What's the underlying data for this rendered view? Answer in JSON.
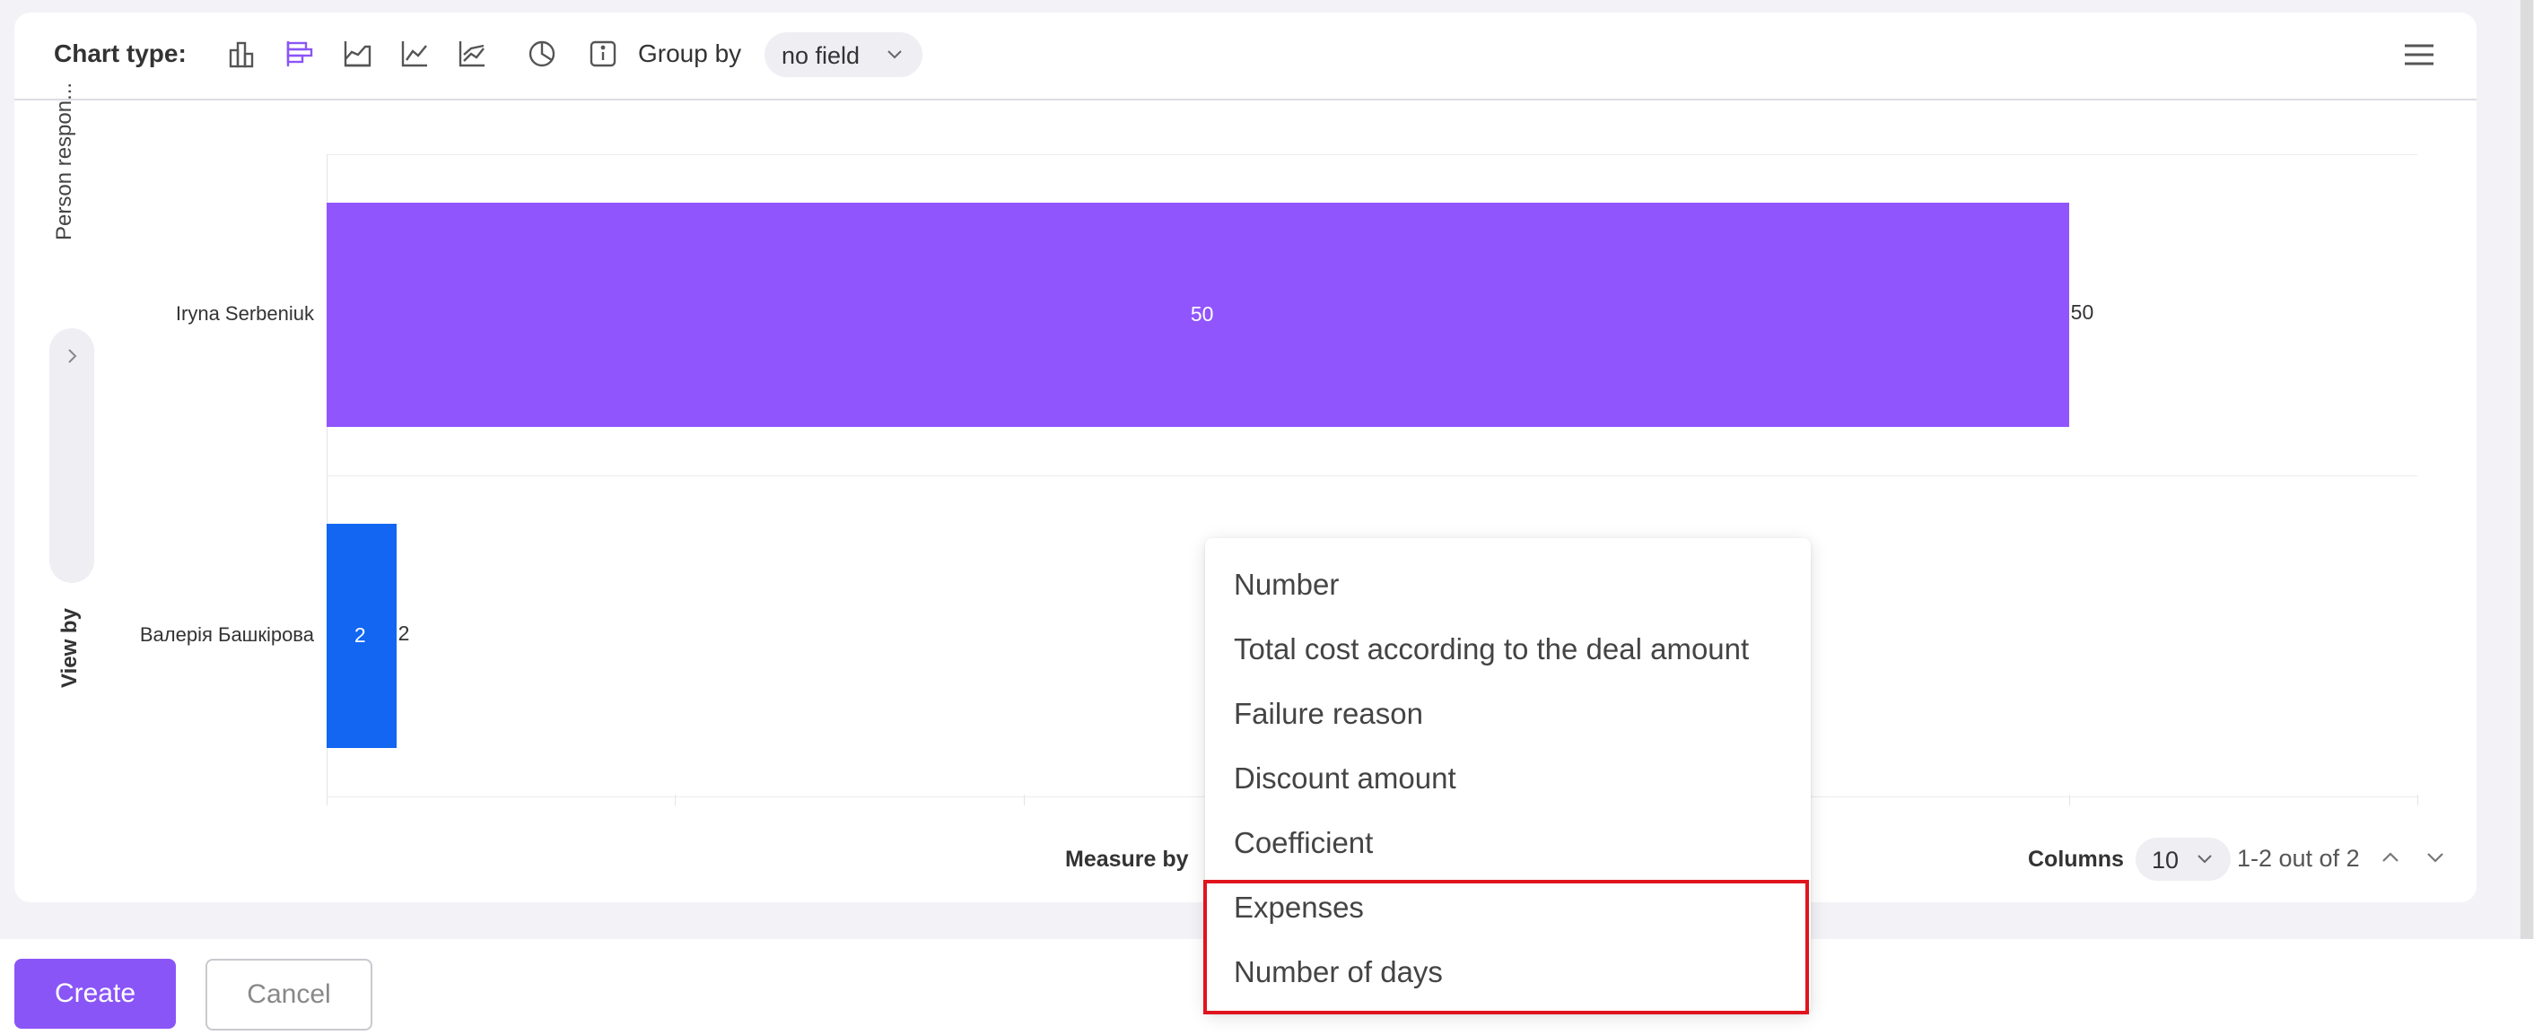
{
  "toolbar": {
    "chart_type_label": "Chart type:",
    "group_by_label": "Group by",
    "group_by_value": "no field"
  },
  "view_by": {
    "label": "View by",
    "field": "Person respon..."
  },
  "measure_by_label": "Measure by",
  "measure_options": [
    "Number",
    "Total cost according to the deal amount",
    "Failure reason",
    "Discount amount",
    "Coefficient",
    "Expenses",
    "Number of days"
  ],
  "columns": {
    "label": "Columns",
    "value": "10",
    "pagination": "1-2 out of 2"
  },
  "buttons": {
    "create": "Create",
    "cancel": "Cancel"
  },
  "chart_data": {
    "type": "bar",
    "orientation": "horizontal",
    "categories": [
      "Iryna Serbeniuk",
      "Валерія Башкірова"
    ],
    "values": [
      50,
      2
    ],
    "bar_colors": [
      "#9155fd",
      "#1266f1"
    ],
    "xlim": [
      0,
      60
    ],
    "grid": true
  },
  "colors": {
    "accent": "#8a55f7",
    "highlight": "#e0141e"
  }
}
